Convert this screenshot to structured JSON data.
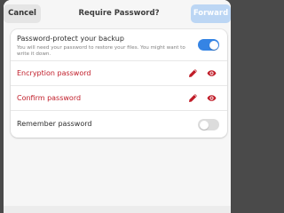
{
  "header": {
    "cancel_label": "Cancel",
    "title": "Require Password?",
    "forward_label": "Forward"
  },
  "settings": {
    "protect": {
      "title": "Password-protect your backup",
      "subtitle": "You will need your password to restore your files. You might want to write it down.",
      "enabled": true
    },
    "encryption_password": {
      "label": "Encryption password",
      "edit_icon": "pencil-icon",
      "reveal_icon": "eye-icon"
    },
    "confirm_password": {
      "label": "Confirm password",
      "edit_icon": "pencil-icon",
      "reveal_icon": "eye-icon"
    },
    "remember": {
      "label": "Remember password",
      "enabled": false
    }
  },
  "colors": {
    "accent": "#3584e4",
    "forward_disabled": "#bcd6f4",
    "error_red": "#c01c28",
    "window_bg": "#f6f6f6"
  }
}
